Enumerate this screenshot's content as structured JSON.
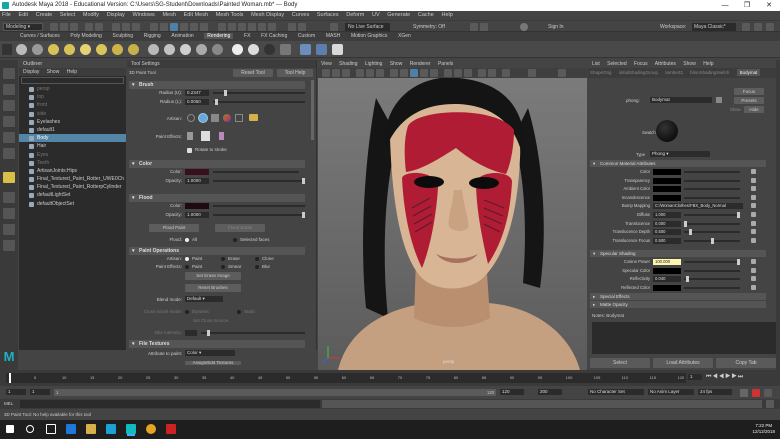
{
  "window": {
    "title": "Autodesk Maya 2018 - Educational Version: C:\\Users\\SG-Student\\Downloads\\Painted Woman.mb* --- Body",
    "controls": [
      "—",
      "❐",
      "✕"
    ]
  },
  "menubar": [
    "File",
    "Edit",
    "Create",
    "Select",
    "Modify",
    "Display",
    "Windows",
    "Mesh",
    "Edit Mesh",
    "Mesh Tools",
    "Mesh Display",
    "Curves",
    "Surfaces",
    "Deform",
    "UV",
    "Generate",
    "Cache",
    "Help"
  ],
  "statusline": {
    "mode": "Modeling",
    "live_surface": "No Live Surface",
    "symmetry": "Symmetry: Off",
    "sign_in": "Sign In",
    "workspace_label": "Workspace:",
    "workspace": "Maya Classic*"
  },
  "shelf_tabs": [
    "Curves / Surfaces",
    "Poly Modeling",
    "Sculpting",
    "Rigging",
    "Animation",
    "Rendering",
    "FX",
    "FX Caching",
    "Custom",
    "MASH",
    "Motion Graphics",
    "XGen"
  ],
  "shelf_active_tab": "Rendering",
  "outliner": {
    "title": "Outliner",
    "menu": [
      "Display",
      "Show",
      "Help"
    ],
    "items": [
      {
        "label": "persp",
        "dim": true,
        "level": 0
      },
      {
        "label": "top",
        "dim": true,
        "level": 0
      },
      {
        "label": "front",
        "dim": true,
        "level": 0
      },
      {
        "label": "side",
        "dim": true,
        "level": 0
      },
      {
        "label": "Eyelashes",
        "dim": false,
        "level": 0
      },
      {
        "label": "default1",
        "dim": false,
        "level": 0
      },
      {
        "label": "Body",
        "dim": false,
        "level": 0,
        "selected": true
      },
      {
        "label": "Hair",
        "dim": false,
        "level": 0
      },
      {
        "label": "Eyes",
        "dim": true,
        "level": 0
      },
      {
        "label": "Teeth",
        "dim": true,
        "level": 0
      },
      {
        "label": "ArtisanJoints:Hips",
        "dim": false,
        "level": 0
      },
      {
        "label": "Final_Textured_Paint_Rotter_UWE0Ch",
        "dim": false,
        "level": 0
      },
      {
        "label": "Final_Textured_Paint_RotterpCylinder",
        "dim": false,
        "level": 0
      },
      {
        "label": "defaultLightSet",
        "dim": false,
        "level": 0
      },
      {
        "label": "defaultObjectSet",
        "dim": false,
        "level": 0
      }
    ]
  },
  "tool_settings": {
    "title": "Tool Settings",
    "tool_name": "3D Paint Tool",
    "reset_label": "Reset Tool",
    "help_label": "Tool Help",
    "brush": {
      "header": "Brush",
      "radius_u_label": "Radius (U):",
      "radius_u": "0.2347",
      "radius_u_fill": 0.12,
      "radius_l_label": "Radius (L):",
      "radius_l": "0.0050",
      "radius_l_fill": 0.02,
      "artisan_label": "Artisan:",
      "paint_effects_label": "Paint Effects:",
      "rotate_label": "Rotate to stroke"
    },
    "color": {
      "header": "Color",
      "color_label": "Color:",
      "color_value": "#3a0f1c",
      "opacity_label": "Opacity:",
      "opacity": "1.0000",
      "opacity_fill": 1.0
    },
    "flood": {
      "header": "Flood",
      "color_label": "Color:",
      "color_value": "#1f0a12",
      "opacity_label": "Opacity:",
      "opacity": "1.0000",
      "opacity_fill": 1.0,
      "flood_paint": "Flood Paint",
      "flood_erase": "Flood Erase",
      "flood_label": "Flood:",
      "flood_all": "All",
      "flood_selected": "Selected faces"
    },
    "paint_ops": {
      "header": "Paint Operations",
      "artisan_label": "Artisan:",
      "op_paint": "Paint",
      "op_erase": "Erase",
      "op_clone": "Clone",
      "pfx_label": "Paint Effects:",
      "pfx_paint": "Paint",
      "pfx_smear": "Smear",
      "pfx_blur": "Blur",
      "set_erase_image": "Set Erase Image",
      "reset_brushes": "Reset Brushes",
      "blend_mode_label": "Blend mode:",
      "blend_mode": "Default",
      "clone_brush_label": "Clone brush mode:",
      "clone_dynamic": "Dynamic",
      "clone_static": "Static",
      "set_clone_source": "Set Clone Source",
      "blur_intensity_label": "Blur intensity:",
      "blur_intensity": "",
      "blur_intensity_fill": 0.06
    },
    "file_textures": {
      "header": "File Textures",
      "attribute_label": "Attribute to paint:",
      "attribute": "Color",
      "assign_label": "Assign/Edit Textures"
    }
  },
  "viewport": {
    "menu": [
      "View",
      "Shading",
      "Lighting",
      "Show",
      "Renderer",
      "Panels"
    ],
    "camera_label": "persp"
  },
  "attribute_editor": {
    "menu": [
      "List",
      "Selected",
      "Focus",
      "Attributes",
      "Show",
      "Help"
    ],
    "tabs": [
      "ShapeOrig",
      "initialShadingGroup",
      "lambert2",
      "blinnShadingSwitch",
      "Bodymat"
    ],
    "active_tab": "Bodymat",
    "shader_label": "phong:",
    "shader_name": "Bodymat",
    "focus_btn": "Focus",
    "presets_btn": "Presets",
    "show_label": "Show",
    "hide_btn": "Hide",
    "swatch_label": "Swatch",
    "type_label": "Type",
    "type_value": "Phong",
    "common_header": "Common Material Attributes",
    "attrs": [
      {
        "label": "Color",
        "kind": "swatch",
        "value": "#000000"
      },
      {
        "label": "Transparency",
        "kind": "swatch",
        "value": "#000000"
      },
      {
        "label": "Ambient Color",
        "kind": "swatch",
        "value": "#000000"
      },
      {
        "label": "Incandescence",
        "kind": "swatch",
        "value": "#000000"
      },
      {
        "label": "Bump Mapping",
        "kind": "text",
        "value": "C:/WomanClothes/FBX_Body_Normal"
      },
      {
        "label": "Diffuse",
        "kind": "num",
        "value": "1.000",
        "fill": 1.0
      },
      {
        "label": "Translucence",
        "kind": "num",
        "value": "0.000",
        "fill": 0.0
      },
      {
        "label": "Translucence Depth",
        "kind": "num",
        "value": "0.500",
        "fill": 0.1
      },
      {
        "label": "Translucence Focus",
        "kind": "num",
        "value": "0.500",
        "fill": 0.5
      }
    ],
    "specular_header": "Specular Shading",
    "specular": [
      {
        "label": "Cosine Power",
        "kind": "num",
        "value": "100.000",
        "fill": 1.0,
        "highlight": true
      },
      {
        "label": "Specular Color",
        "kind": "swatch",
        "value": "#000000"
      },
      {
        "label": "Reflectivity",
        "kind": "num",
        "value": "0.040",
        "fill": 0.04
      },
      {
        "label": "Reflected Color",
        "kind": "swatch",
        "value": "#000000"
      }
    ],
    "closed_sections": [
      "Special Effects",
      "Matte Opacity"
    ],
    "notes_label": "Notes: Bodymat",
    "select_btn": "Select",
    "load_btn": "Load Attributes",
    "copy_btn": "Copy Tab"
  },
  "time_slider": {
    "ticks": [
      "5",
      "10",
      "15",
      "20",
      "25",
      "30",
      "35",
      "40",
      "45",
      "50",
      "55",
      "60",
      "65",
      "70",
      "75",
      "80",
      "85",
      "90",
      "95",
      "100",
      "105",
      "110",
      "115",
      "120"
    ],
    "current_frame": "1"
  },
  "range_slider": {
    "start": "1",
    "start2": "1",
    "range_start": "1",
    "range_end": "120",
    "end": "120",
    "end2": "200",
    "character_set": "No Character Set",
    "anim_layer": "No Anim Layer",
    "fps": "24 fps"
  },
  "command_line": {
    "label": "MEL",
    "value": ""
  },
  "help_line": "3D Paint Tool: No help available for this tool",
  "taskbar": {
    "time": "7:22 PM",
    "date": "12/12/2018"
  },
  "colors": {
    "face_paint": "#b01c34",
    "skin": "#d8b594",
    "hair": "#161616",
    "selection": "#5285a6"
  }
}
